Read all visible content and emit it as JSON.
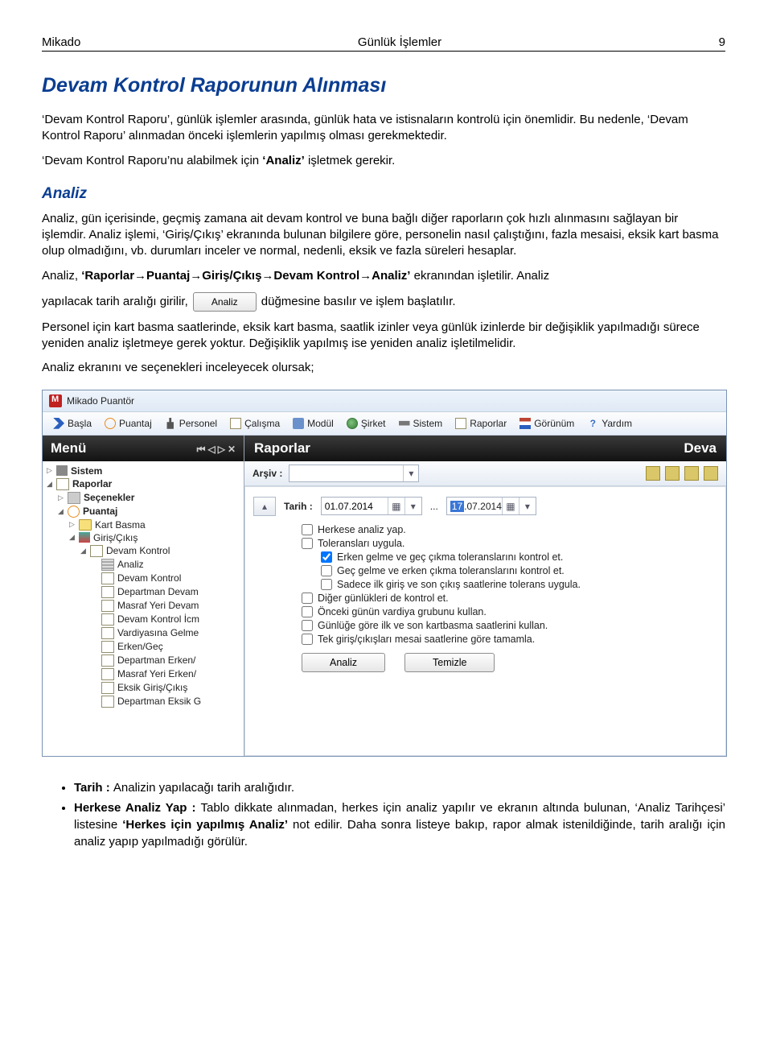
{
  "header": {
    "left": "Mikado",
    "center": "Günlük İşlemler",
    "right": "9"
  },
  "h1": "Devam Kontrol Raporunun Alınması",
  "p1": "‘Devam Kontrol Raporu’, günlük işlemler arasında, günlük hata ve istisnaların kontrolü için önemlidir. Bu nedenle, ‘Devam Kontrol Raporu’ alınmadan önceki işlemlerin yapılmış olması gerekmektedir.",
  "p2_a": "‘Devam Kontrol Raporu’nu alabilmek için ",
  "p2_b": "‘Analiz’",
  "p2_c": " işletmek gerekir.",
  "h2": "Analiz",
  "p3": "Analiz, gün içerisinde, geçmiş zamana ait devam kontrol ve buna bağlı diğer raporların çok hızlı alınmasını sağlayan bir işlemdir. Analiz işlemi, ‘Giriş/Çıkış’ ekranında bulunan bilgilere göre, personelin nasıl çalıştığını, fazla mesaisi, eksik kart basma olup olmadığını, vb. durumları inceler ve normal, nedenli, eksik ve fazla süreleri hesaplar.",
  "p4_a": "Analiz, ",
  "p4_b": "‘Raporlar→Puantaj→Giriş/Çıkış→Devam Kontrol→Analiz’",
  "p4_c": " ekranından işletilir. Analiz",
  "p5_a": "yapılacak tarih aralığı girilir, ",
  "inline_btn": "Analiz",
  "p5_b": " düğmesine basılır ve işlem başlatılır.",
  "p6": "Personel için kart basma saatlerinde, eksik kart basma, saatlik izinler veya günlük izinlerde bir değişiklik yapılmadığı sürece yeniden analiz işletmeye gerek yoktur. Değişiklik yapılmış ise yeniden analiz işletilmelidir.",
  "p7": "Analiz ekranını ve seçenekleri inceleyecek olursak;",
  "app": {
    "title": "Mikado Puantör",
    "menu": [
      "Başla",
      "Puantaj",
      "Personel",
      "Çalışma",
      "Modül",
      "Şirket",
      "Sistem",
      "Raporlar",
      "Görünüm",
      "Yardım"
    ],
    "sidebar_title": "Menü",
    "tree": {
      "sistem": "Sistem",
      "raporlar": "Raporlar",
      "secenekler": "Seçenekler",
      "puantaj": "Puantaj",
      "kartbasma": "Kart Basma",
      "giriscikis": "Giriş/Çıkış",
      "devamkontrol": "Devam Kontrol",
      "analiz": "Analiz",
      "dk2": "Devam Kontrol",
      "dep": "Departman Devam",
      "mas": "Masraf Yeri Devam",
      "dki": "Devam Kontrol İcm",
      "varg": "Vardiyasına Gelme",
      "erg": "Erken/Geç",
      "depe": "Departman Erken/",
      "mye": "Masraf Yeri Erken/",
      "egc": "Eksik Giriş/Çıkış",
      "depek": "Departman Eksik G"
    },
    "main_title": "Raporlar",
    "main_right": "Deva",
    "arsiv_label": "Arşiv :",
    "tarih_label": "Tarih :",
    "date1": "01.07.2014",
    "date2_pre": "17",
    "date2_post": ".07.2014",
    "opts": {
      "a": "Herkese analiz yap.",
      "b": "Toleransları uygula.",
      "c": "Erken gelme ve geç çıkma toleranslarını kontrol et.",
      "d": "Geç gelme ve erken çıkma toleranslarını kontrol et.",
      "e": "Sadece ilk giriş ve son çıkış saatlerine tolerans uygula.",
      "f": "Diğer günlükleri de kontrol et.",
      "g": "Önceki günün vardiya grubunu kullan.",
      "h": "Günlüğe göre ilk ve son kartbasma saatlerini kullan.",
      "i": "Tek giriş/çıkışları mesai saatlerine göre tamamla."
    },
    "btn_analiz": "Analiz",
    "btn_temizle": "Temizle"
  },
  "defs": {
    "d1_a": "Tarih : ",
    "d1_b": "Analizin yapılacağı tarih aralığıdır.",
    "d2_a": "Herkese Analiz Yap : ",
    "d2_b": "Tablo dikkate alınmadan, herkes için analiz yapılır ve ekranın altında bulunan, ‘Analiz Tarihçesi’ listesine ",
    "d2_c": "‘Herkes için yapılmış Analiz’",
    "d2_d": " not edilir. Daha sonra listeye bakıp, rapor almak istenildiğinde, tarih aralığı için analiz yapıp yapılmadığı görülür."
  }
}
